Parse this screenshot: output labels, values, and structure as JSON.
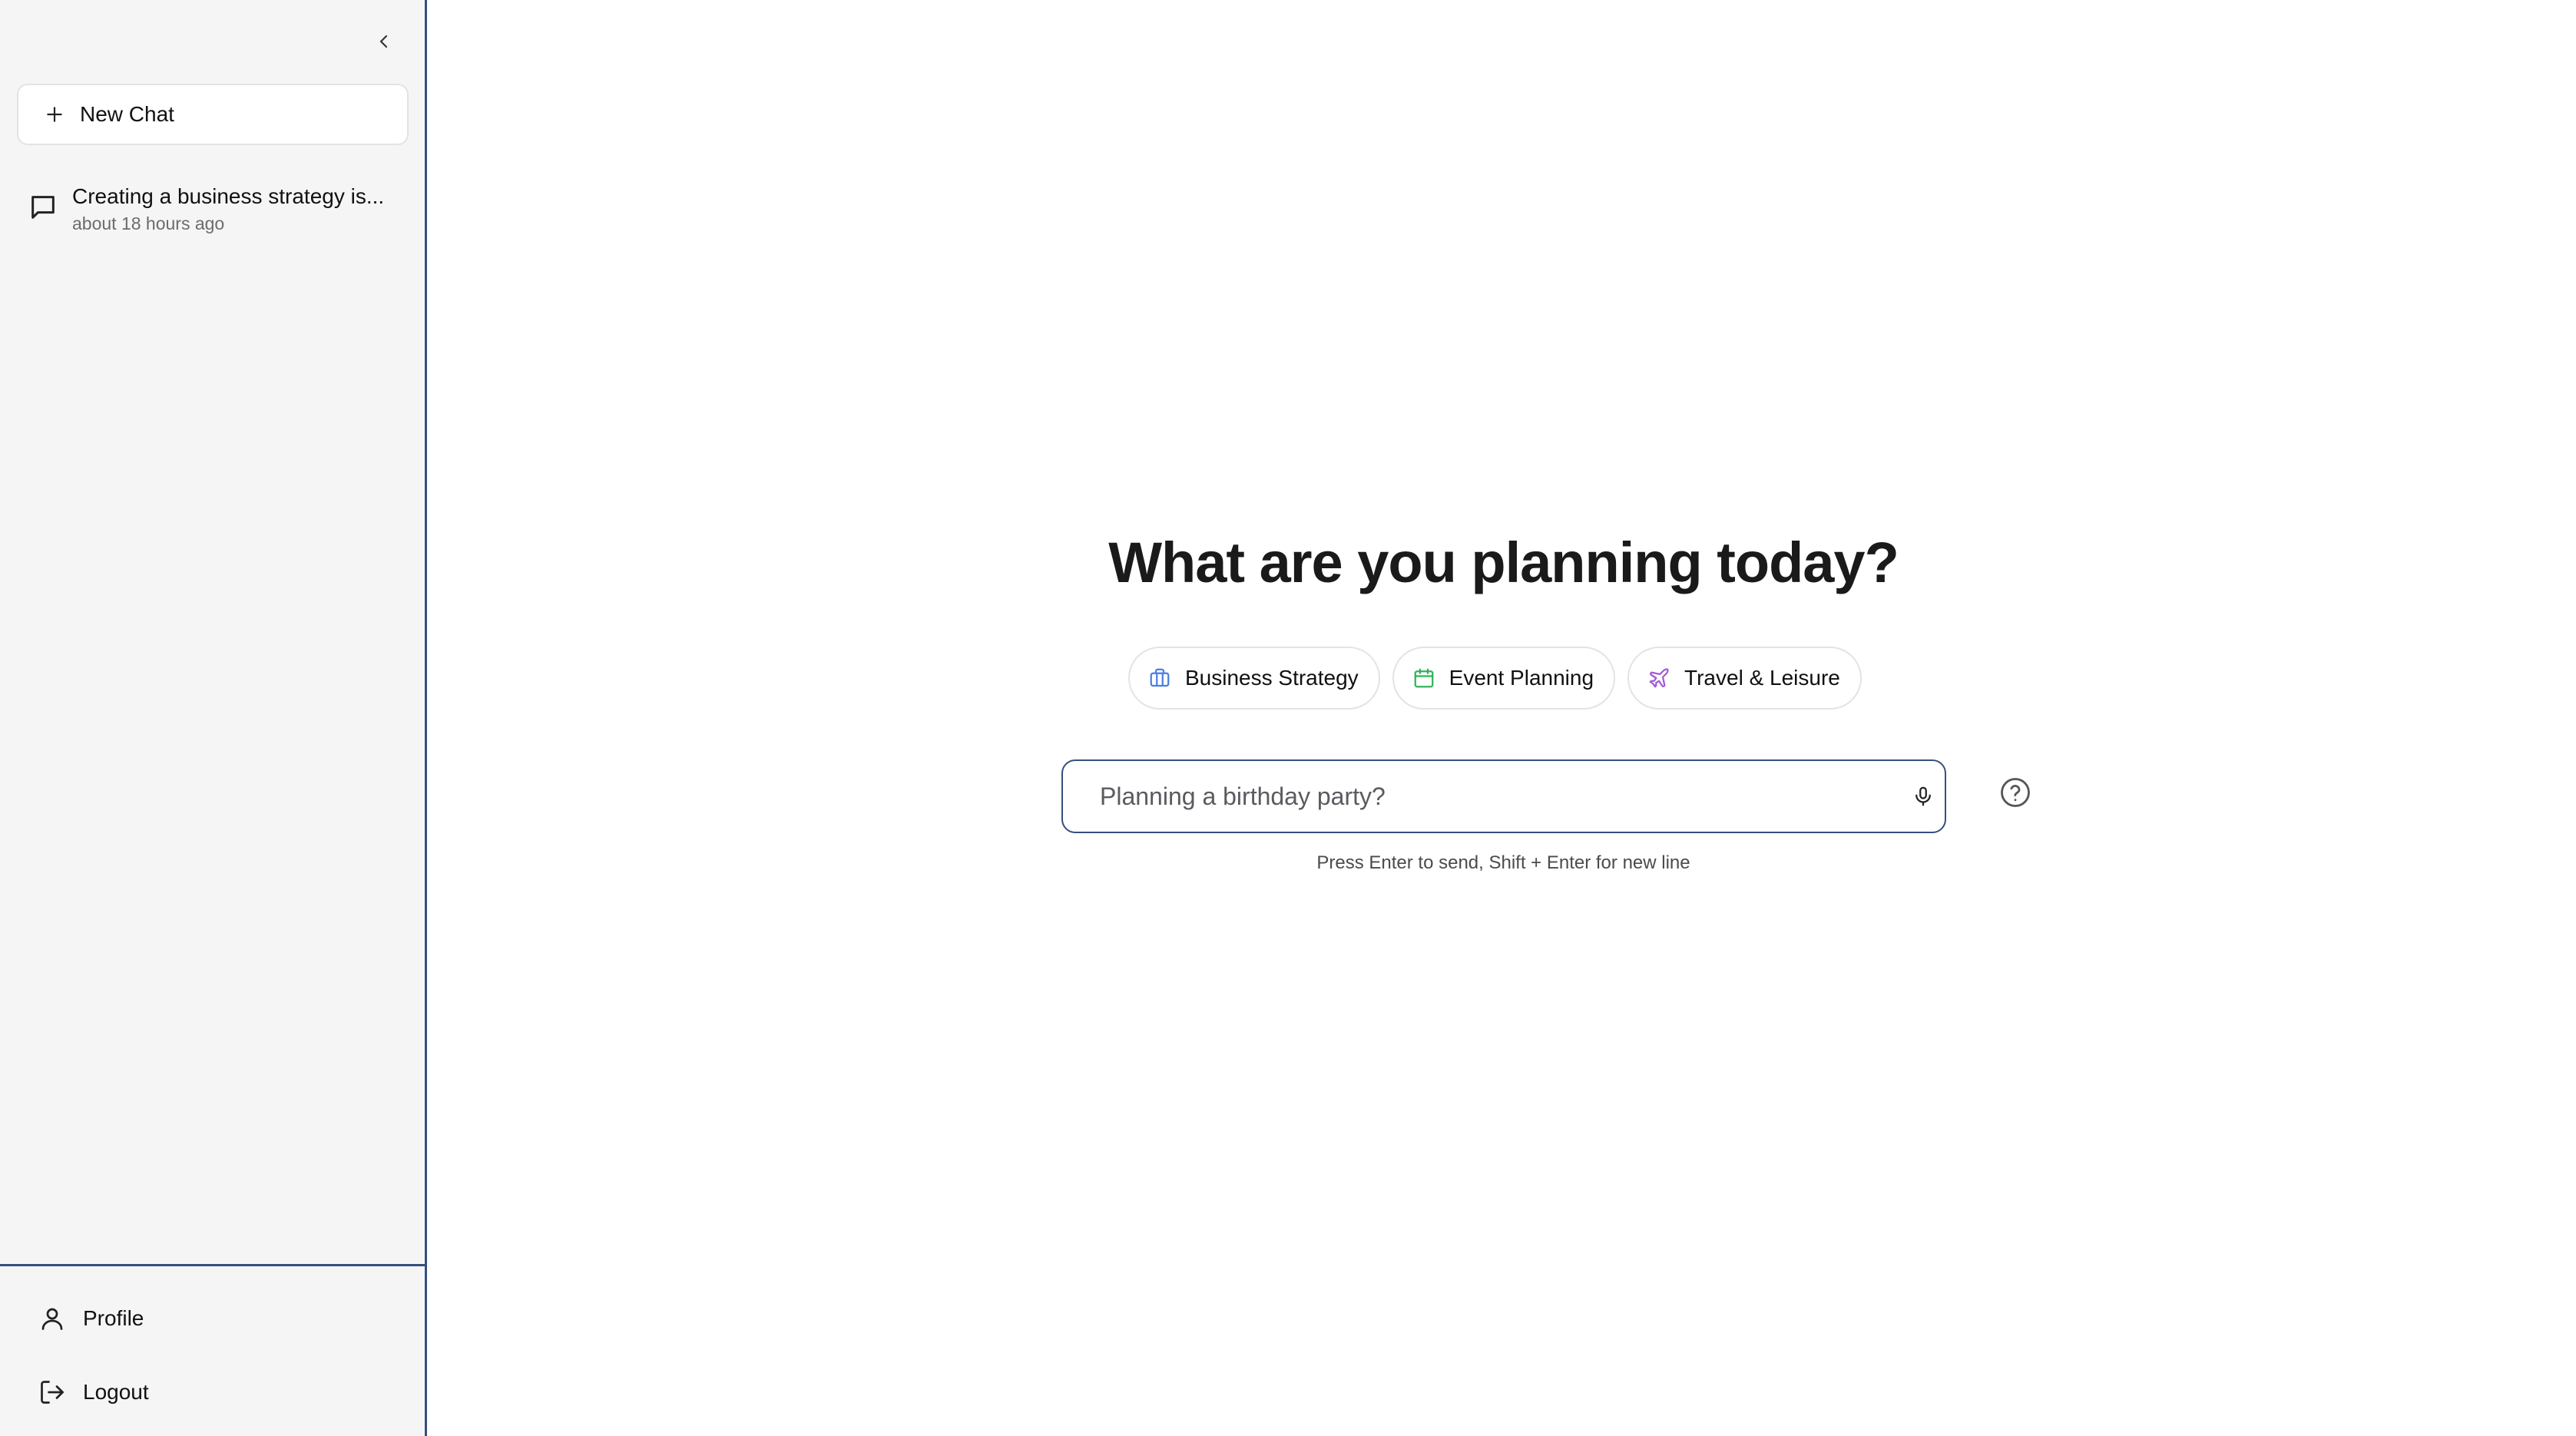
{
  "sidebar": {
    "new_chat_label": "New Chat",
    "history": [
      {
        "title": "Creating a business strategy is...",
        "time": "about 18 hours ago"
      }
    ],
    "footer": {
      "profile_label": "Profile",
      "logout_label": "Logout"
    }
  },
  "main": {
    "headline": "What are you planning today?",
    "chips": [
      {
        "label": "Business Strategy",
        "icon": "briefcase-icon",
        "color": "#4a7fe0"
      },
      {
        "label": "Event Planning",
        "icon": "calendar-icon",
        "color": "#2fb35a"
      },
      {
        "label": "Travel & Leisure",
        "icon": "plane-icon",
        "color": "#a35ad8"
      }
    ],
    "input": {
      "placeholder": "Planning a birthday party?",
      "value": ""
    },
    "hint": "Press Enter to send, Shift + Enter for new line"
  },
  "colors": {
    "accent": "#35507e",
    "sidebar_bg": "#f5f5f6"
  }
}
